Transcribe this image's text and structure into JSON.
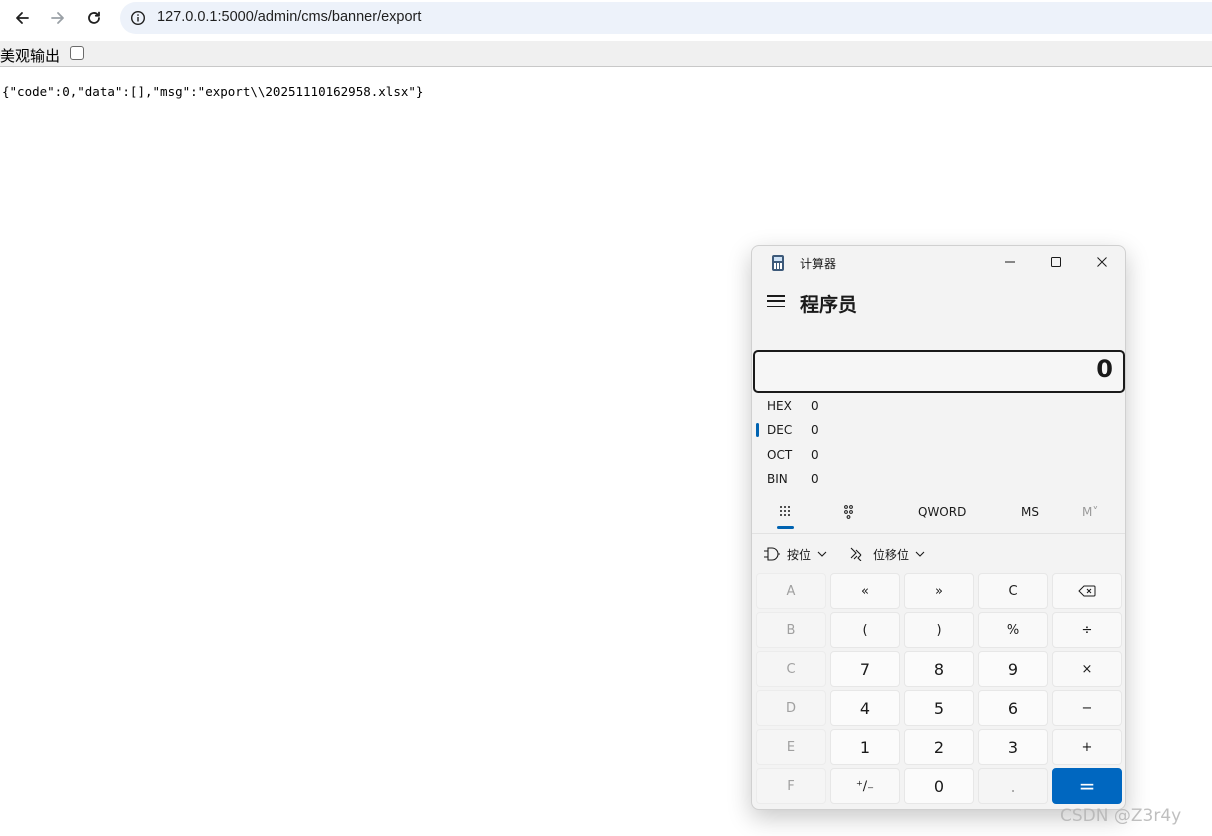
{
  "browser": {
    "url": "127.0.0.1:5000/admin/cms/banner/export"
  },
  "json_viewer": {
    "pretty_label": "美观输出",
    "pretty_checked": false,
    "body_text": "{\"code\":0,\"data\":[],\"msg\":\"export\\\\20251110162958.xlsx\"}"
  },
  "calculator": {
    "window_title": "计算器",
    "mode_title": "程序员",
    "display_value": "0",
    "radix": [
      {
        "label": "HEX",
        "value": "0",
        "active": false
      },
      {
        "label": "DEC",
        "value": "0",
        "active": true
      },
      {
        "label": "OCT",
        "value": "0",
        "active": false
      },
      {
        "label": "BIN",
        "value": "0",
        "active": false
      }
    ],
    "toolbar": {
      "word_size": "QWORD",
      "ms": "MS",
      "mv": "M˅"
    },
    "bitwise_label": "按位",
    "bitshift_label": "位移位",
    "keys": {
      "r1": [
        "A",
        "«",
        "»",
        "C",
        "⌫"
      ],
      "r2": [
        "B",
        "(",
        ")",
        "%",
        "÷"
      ],
      "r3": [
        "C",
        "7",
        "8",
        "9",
        "×"
      ],
      "r4": [
        "D",
        "4",
        "5",
        "6",
        "−"
      ],
      "r5": [
        "E",
        "1",
        "2",
        "3",
        "+"
      ],
      "r6": [
        "F",
        "⁺∕₋",
        "0",
        ".",
        "="
      ]
    },
    "colors": {
      "accent": "#0067c0"
    }
  },
  "watermark": "CSDN @Z3r4y"
}
